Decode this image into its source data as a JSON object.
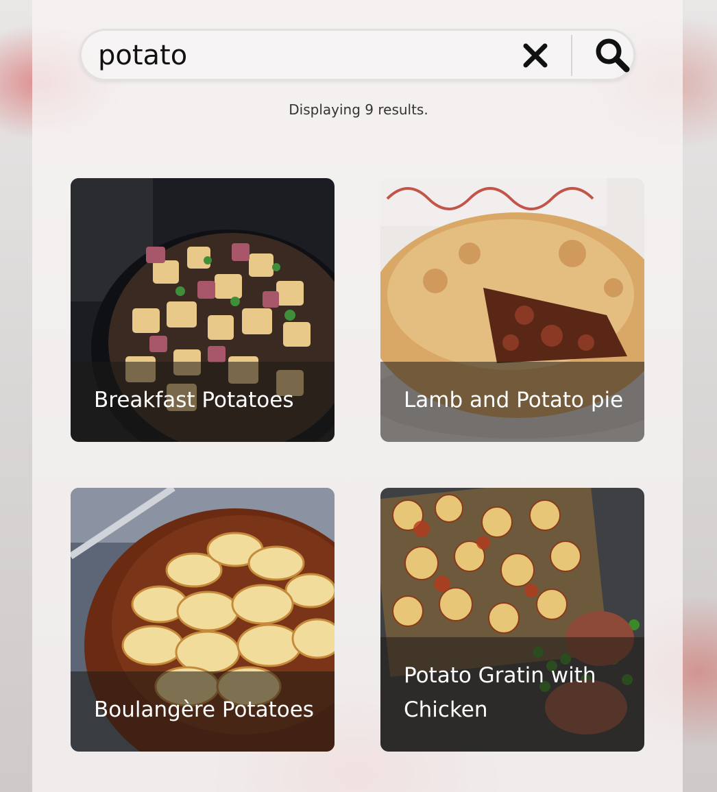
{
  "search": {
    "query": "potato",
    "clear_icon": "close-icon",
    "submit_icon": "search-icon"
  },
  "results": {
    "status_text": "Displaying 9 results.",
    "cards": [
      {
        "title": "Breakfast Potatoes"
      },
      {
        "title": "Lamb and Potato pie"
      },
      {
        "title": "Boulangère Potatoes"
      },
      {
        "title": "Potato Gratin with Chicken"
      }
    ]
  },
  "colors": {
    "text_primary": "#111111",
    "card_title": "#ffffff",
    "overlay": "#1e1916"
  }
}
